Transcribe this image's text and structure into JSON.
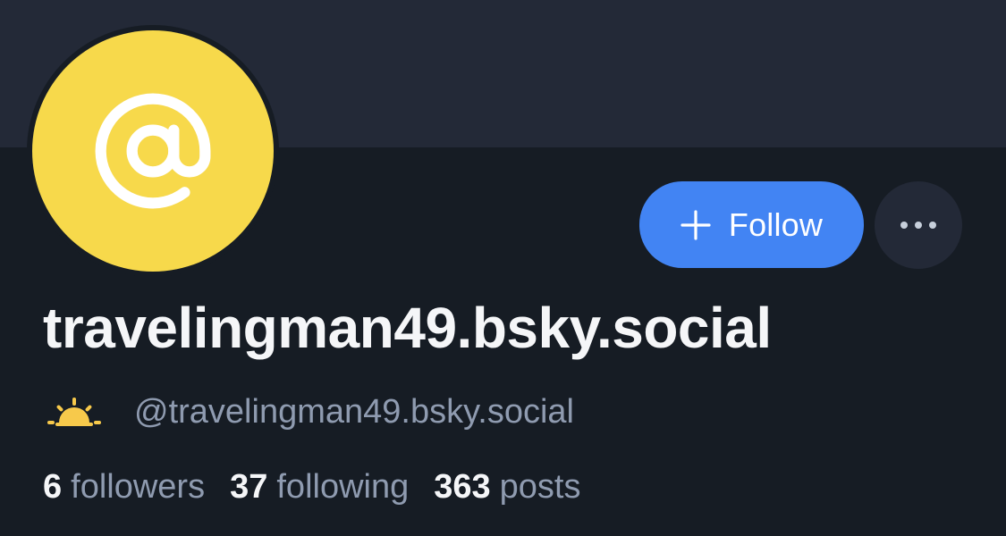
{
  "profile": {
    "display_name": "travelingman49.bsky.social",
    "handle": "@travelingman49.bsky.social",
    "avatar_icon": "at-sign-icon",
    "handle_prefix_icon": "sunrise-icon"
  },
  "actions": {
    "follow_label": "Follow",
    "follow_icon": "plus-icon",
    "more_icon": "ellipsis-icon"
  },
  "stats": {
    "followers_count": "6",
    "followers_label": "followers",
    "following_count": "37",
    "following_label": "following",
    "posts_count": "363",
    "posts_label": "posts"
  },
  "colors": {
    "accent": "#4284f3",
    "avatar_background": "#f7d94b",
    "page_background": "#161c24",
    "banner_background": "#232937",
    "muted_text": "#8f9bb0"
  }
}
